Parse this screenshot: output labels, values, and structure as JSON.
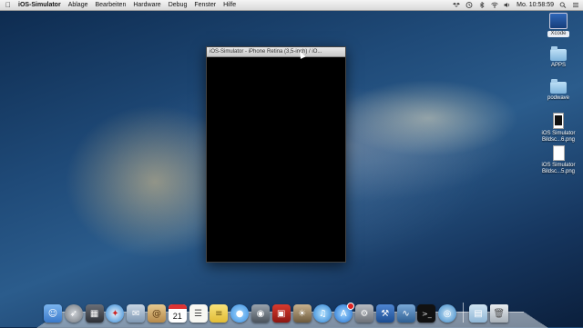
{
  "menubar": {
    "app_name": "iOS-Simulator",
    "menus": [
      "Ablage",
      "Bearbeiten",
      "Hardware",
      "Debug",
      "Fenster",
      "Hilfe"
    ],
    "clock": "Mo. 10:58:59"
  },
  "simulator_window": {
    "title": "iOS-Simulator - iPhone Retina (3,5-inch) / iO..."
  },
  "desktop": {
    "xcode_label": "Xcode",
    "folders": [
      "APPS",
      "podwave"
    ],
    "files": [
      {
        "name_line1": "iOS Simulator",
        "name_line2": "Bildsc...6.png"
      },
      {
        "name_line1": "iOS Simulator",
        "name_line2": "Bildsc...5.png"
      }
    ]
  },
  "dock": {
    "calendar_day": "21",
    "icons": [
      "finder-icon",
      "launchpad-icon",
      "mission-control-icon",
      "safari-icon",
      "mail-icon",
      "contacts-icon",
      "calendar-icon",
      "reminders-icon",
      "notes-icon",
      "messages-icon",
      "facetime-icon",
      "photo-booth-icon",
      "iphoto-icon",
      "itunes-icon",
      "app-store-icon",
      "system-preferences-icon",
      "xcode-icon",
      "instruments-icon",
      "terminal-icon",
      "network-utility-icon",
      "documents-folder-icon",
      "trash-icon"
    ]
  },
  "colors": {
    "menubar_bg": "#e6e6e6",
    "sim_screen": "#000000",
    "wallpaper_deep": "#0d2a4e"
  }
}
